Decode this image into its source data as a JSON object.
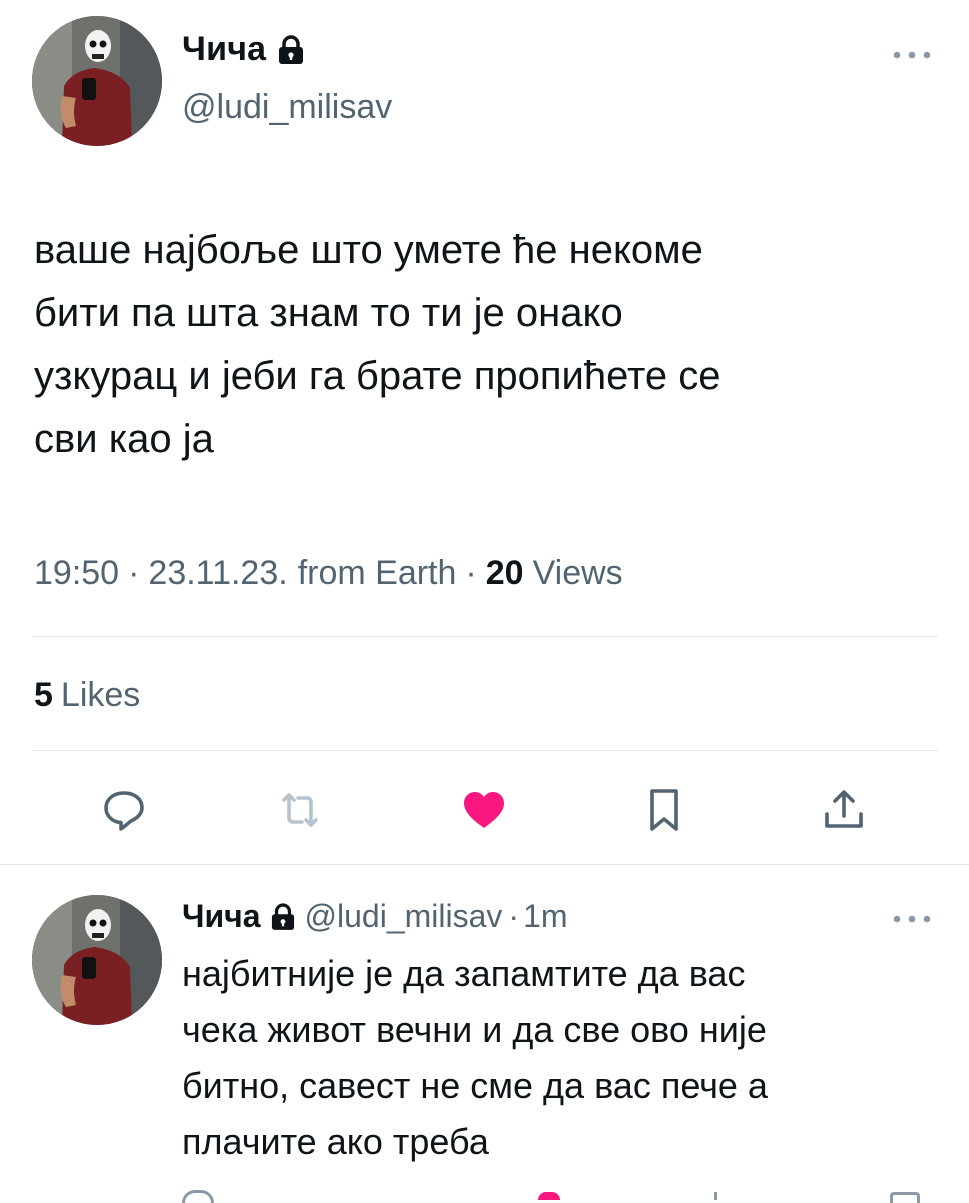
{
  "tweet": {
    "display_name": "Чича",
    "handle": "@ludi_milisav",
    "text": "ваше најбоље што умете ће некоме\nбити па шта знам то ти је онако\nузкурац и јеби га брате пропићете се\nсви као ја",
    "time": "19:50",
    "date": "23.11.23.",
    "source": "from Earth",
    "views_count": "20",
    "views_label": "Views",
    "likes_count": "5",
    "likes_label": "Likes",
    "liked": true,
    "icons": [
      "lock-icon",
      "more-icon",
      "reply-icon",
      "retweet-icon",
      "heart-icon",
      "bookmark-icon",
      "share-icon"
    ]
  },
  "reply": {
    "display_name": "Чича",
    "handle": "@ludi_milisav",
    "age": "1m",
    "text": "најбитније је да запамтите да вас\nчека живот вечни и да све ово није\nбитно, савест не сме да вас пече а\nплачите ако треба"
  },
  "colors": {
    "heart": "#f91880",
    "secondary_text": "#536471",
    "primary_text": "#0f1419",
    "divider": "#e1e6ea",
    "retweet_disabled": "#b7c3cc"
  }
}
